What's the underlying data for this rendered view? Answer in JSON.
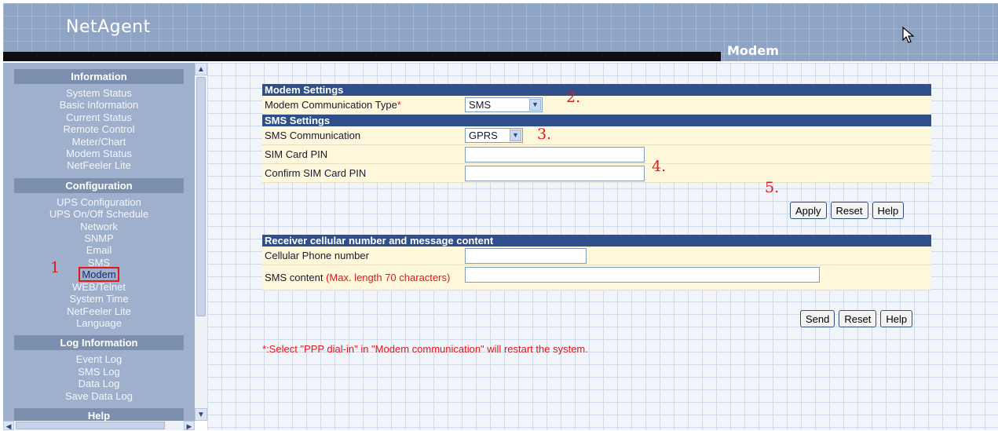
{
  "header": {
    "logo": "NetAgent",
    "section_title": "Modem"
  },
  "sidebar": {
    "groups": [
      {
        "title": "Information",
        "items": [
          "System Status",
          "Basic Information",
          "Current Status",
          "Remote Control",
          "Meter/Chart",
          "Modem Status",
          "NetFeeler Lite"
        ]
      },
      {
        "title": "Configuration",
        "items": [
          "UPS Configuration",
          "UPS On/Off Schedule",
          "Network",
          "SNMP",
          "Email",
          "SMS",
          "Modem",
          "WEB/Telnet",
          "System Time",
          "NetFeeler Lite",
          "Language"
        ]
      },
      {
        "title": "Log Information",
        "items": [
          "Event Log",
          "SMS Log",
          "Data Log",
          "Save Data Log"
        ]
      },
      {
        "title": "Help",
        "items": []
      }
    ]
  },
  "annotations": {
    "step1": "1",
    "step2": "2.",
    "step3": "3.",
    "step4": "4.",
    "step5": "5."
  },
  "modem_settings": {
    "header": "Modem Settings",
    "comm_type_label": "Modem Communication Type",
    "required_mark": "*",
    "comm_type_value": "SMS"
  },
  "sms_settings": {
    "header": "SMS Settings",
    "sms_comm_label": "SMS Communication",
    "sms_comm_value": "GPRS",
    "pin_label": "SIM Card PIN",
    "pin_value": "",
    "confirm_pin_label": "Confirm SIM Card PIN",
    "confirm_pin_value": ""
  },
  "settings_buttons": {
    "apply": "Apply",
    "reset": "Reset",
    "help": "Help"
  },
  "receiver": {
    "header": "Receiver cellular number and message content",
    "phone_label": "Cellular Phone number",
    "phone_value": "",
    "content_label": "SMS content",
    "content_hint": "(Max. length 70 characters)",
    "content_value": ""
  },
  "receiver_buttons": {
    "send": "Send",
    "reset": "Reset",
    "help": "Help"
  },
  "footnote": "*:Select \"PPP dial-in\" in \"Modem communication\" will restart the system."
}
